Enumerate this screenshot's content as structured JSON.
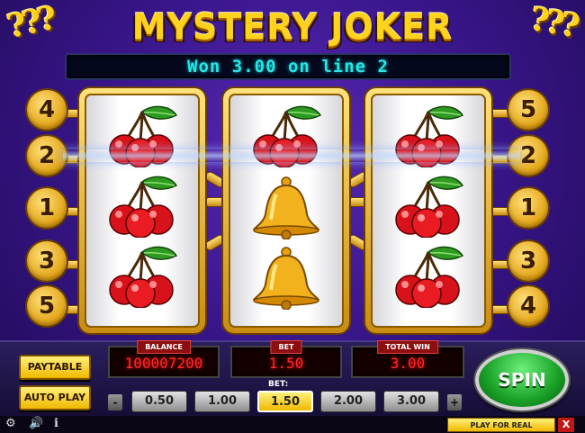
{
  "title": "MYSTERY JOKER",
  "message": "Won 3.00 on line 2",
  "reels": [
    [
      "cherry-icon",
      "cherry-icon",
      "cherry-icon"
    ],
    [
      "cherry-icon",
      "bell-icon",
      "bell-icon"
    ],
    [
      "cherry-icon",
      "cherry-icon",
      "cherry-icon"
    ]
  ],
  "lines_left": [
    "4",
    "2",
    "1",
    "3",
    "5"
  ],
  "lines_right": [
    "5",
    "2",
    "1",
    "3",
    "4"
  ],
  "displays": {
    "balance_label": "BALANCE",
    "balance_value": "100007200",
    "bet_label": "BET",
    "bet_value": "1.50",
    "win_label": "TOTAL WIN",
    "win_value": "3.00"
  },
  "buttons": {
    "paytable": "PAYTABLE",
    "autoplay": "AUTO PLAY",
    "spin": "SPIN",
    "play_for_real": "PLAY FOR REAL",
    "close": "X",
    "bet_minus": "-",
    "bet_plus": "+"
  },
  "bet_selector": {
    "label": "BET:",
    "options": [
      "0.50",
      "1.00",
      "1.50",
      "2.00",
      "3.00"
    ],
    "selected": "1.50"
  },
  "colors": {
    "background": "#3a168c",
    "title": "#ffd31c",
    "message": "#28e6e6",
    "display_text": "#ff2a2a",
    "spin": "#18a026"
  }
}
